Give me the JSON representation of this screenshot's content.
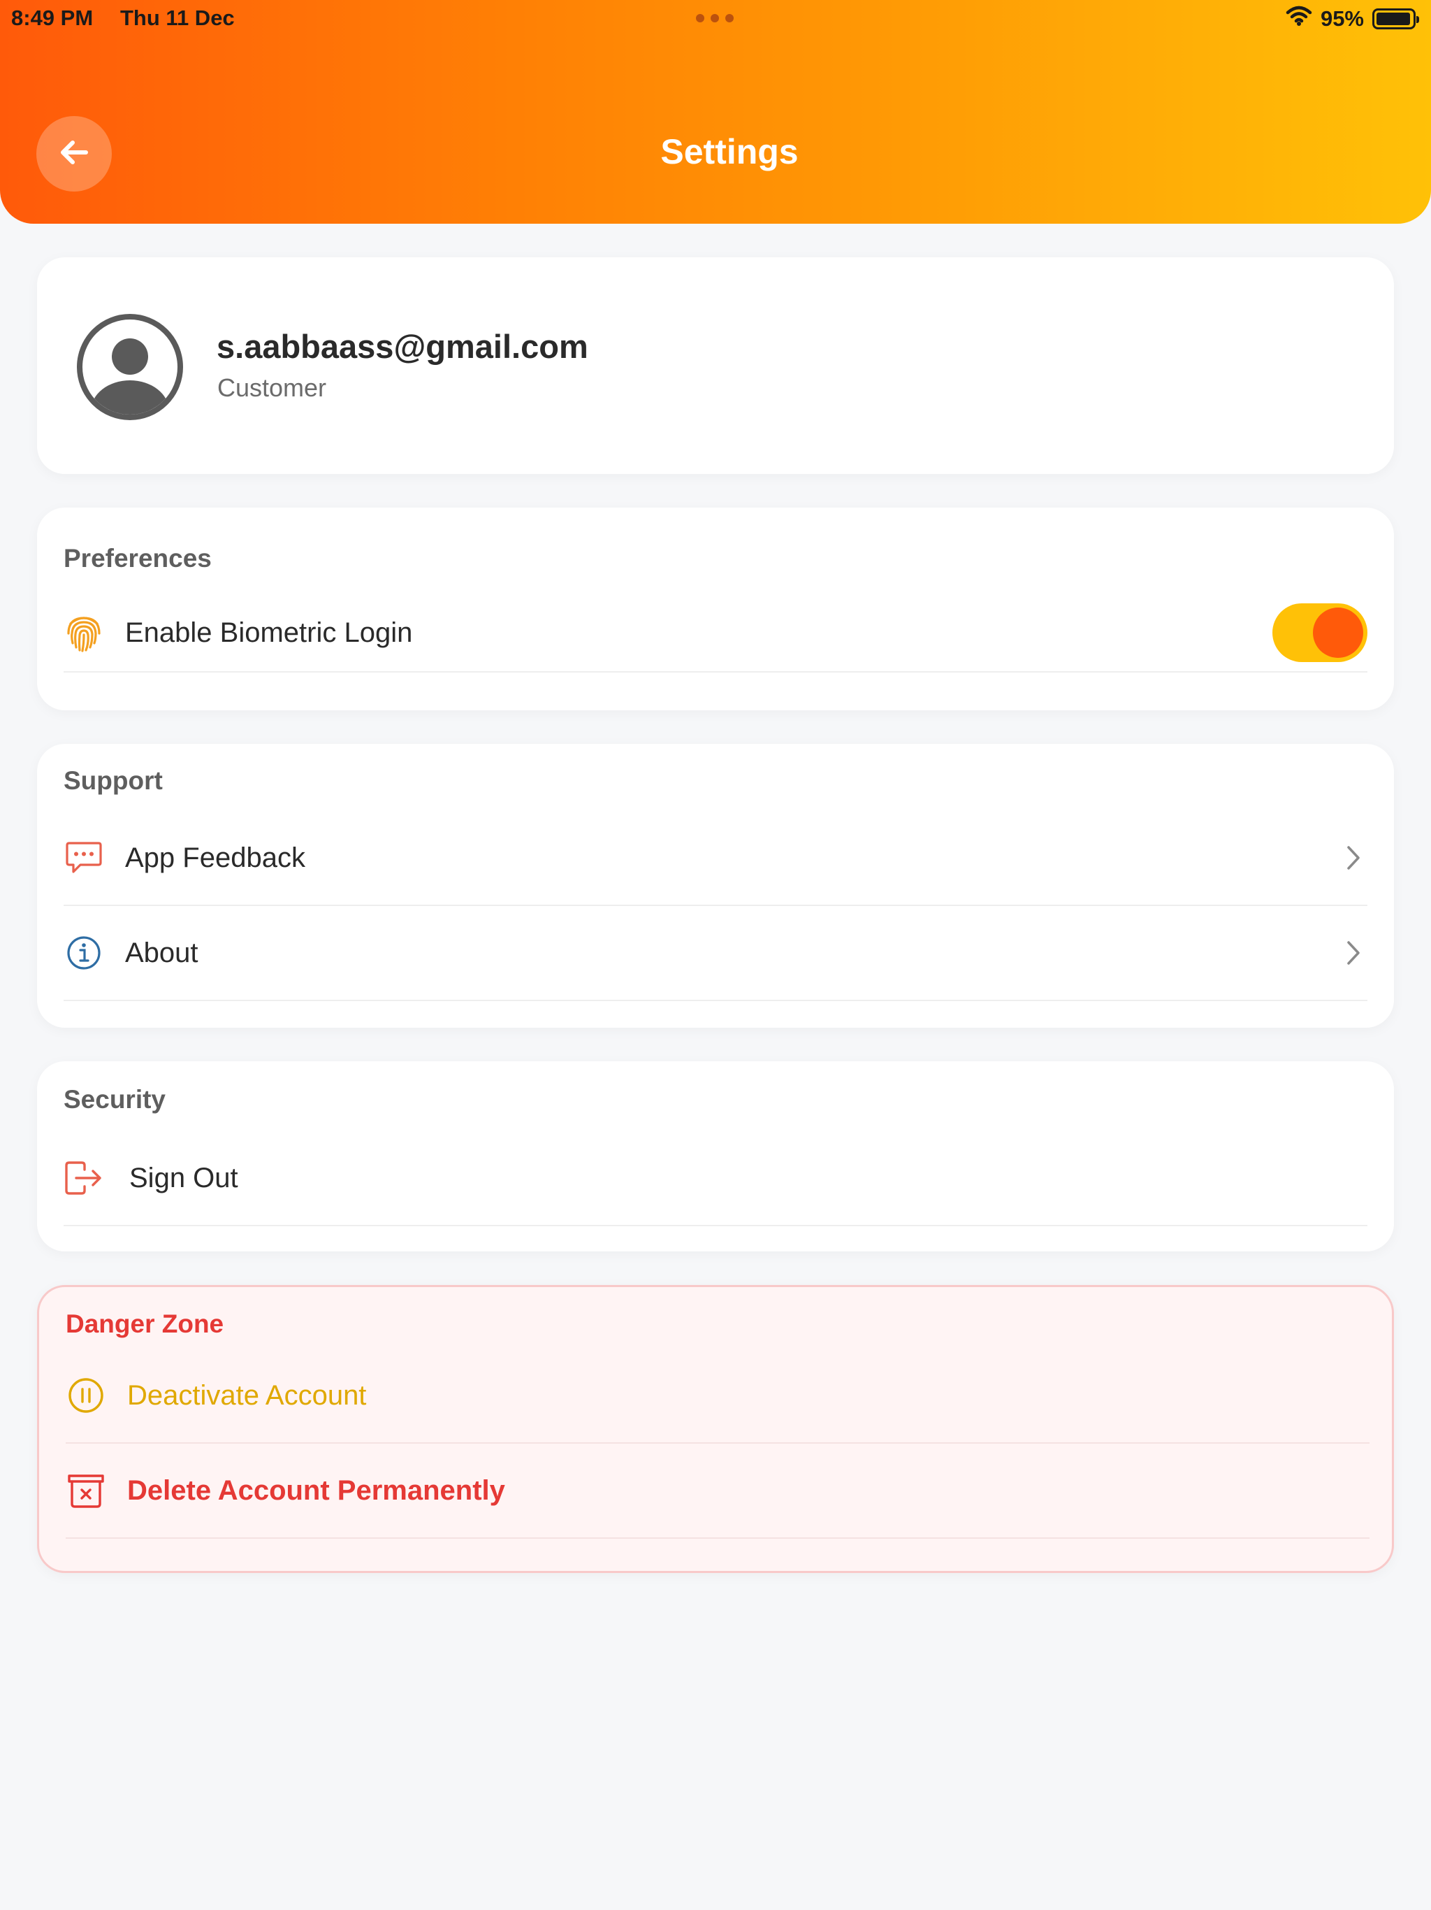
{
  "status_bar": {
    "time": "8:49 PM",
    "date": "Thu 11 Dec",
    "battery": "95%",
    "battery_level": 0.95
  },
  "header": {
    "title": "Settings",
    "back_icon": "arrow-left-icon",
    "gradient_start": "#ff5a0a",
    "gradient_end": "#ffc107"
  },
  "profile": {
    "email": "s.aabbaass@gmail.com",
    "role": "Customer",
    "avatar_icon": "user-circle-icon"
  },
  "preferences": {
    "title": "Preferences",
    "biometric": {
      "label": "Enable Biometric Login",
      "icon": "fingerprint-icon",
      "enabled": true
    }
  },
  "support": {
    "title": "Support",
    "items": [
      {
        "label": "App Feedback",
        "icon": "chat-bubble-icon"
      },
      {
        "label": "About",
        "icon": "info-icon"
      }
    ]
  },
  "security": {
    "title": "Security",
    "sign_out": {
      "label": "Sign Out",
      "icon": "sign-out-icon"
    }
  },
  "danger_zone": {
    "title": "Danger Zone",
    "deactivate": {
      "label": "Deactivate Account",
      "icon": "pause-circle-icon",
      "color": "#e0a800"
    },
    "delete": {
      "label": "Delete Account Permanently",
      "icon": "trash-x-icon",
      "color": "#e53935"
    }
  }
}
